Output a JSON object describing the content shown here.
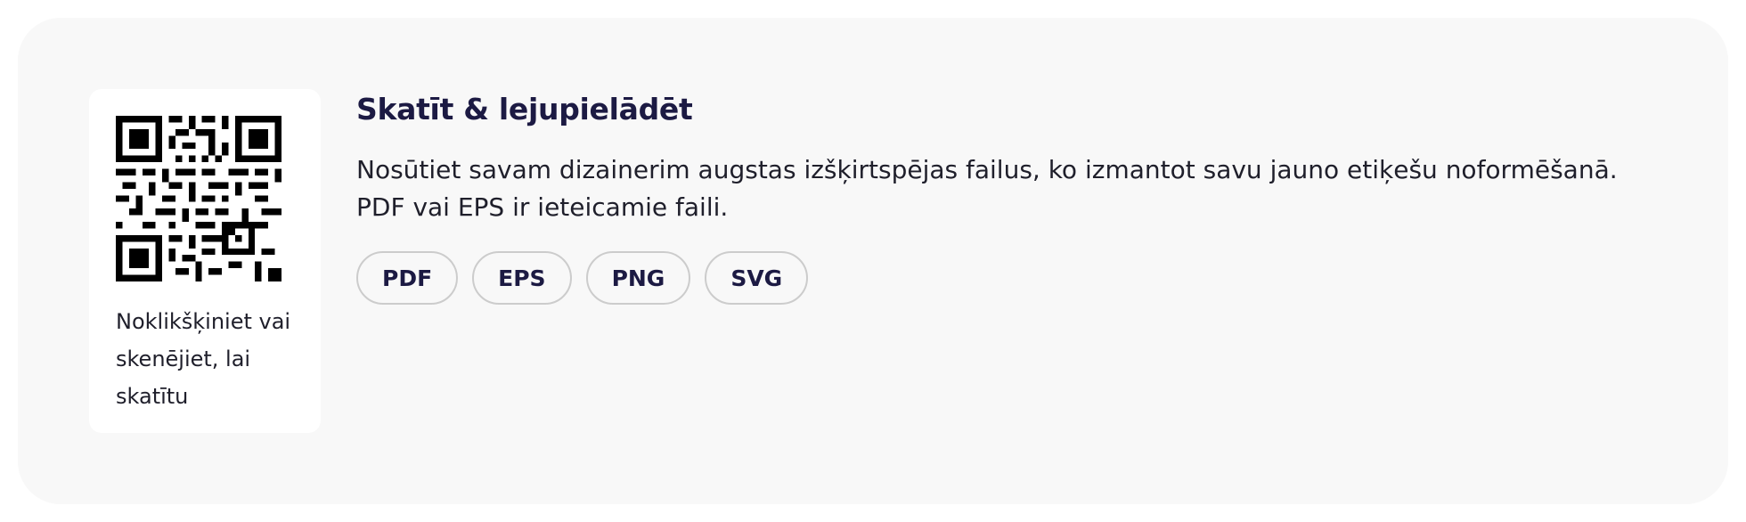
{
  "qr": {
    "caption": "Noklikšķiniet vai skenējiet, lai skatītu"
  },
  "download": {
    "title": "Skatīt & lejupielādēt",
    "description": "Nosūtiet savam dizainerim augstas izšķirtspējas failus, ko izmantot savu jauno etiķešu noformēšanā. PDF vai EPS ir ieteicamie faili.",
    "formats": [
      "PDF",
      "EPS",
      "PNG",
      "SVG"
    ]
  }
}
